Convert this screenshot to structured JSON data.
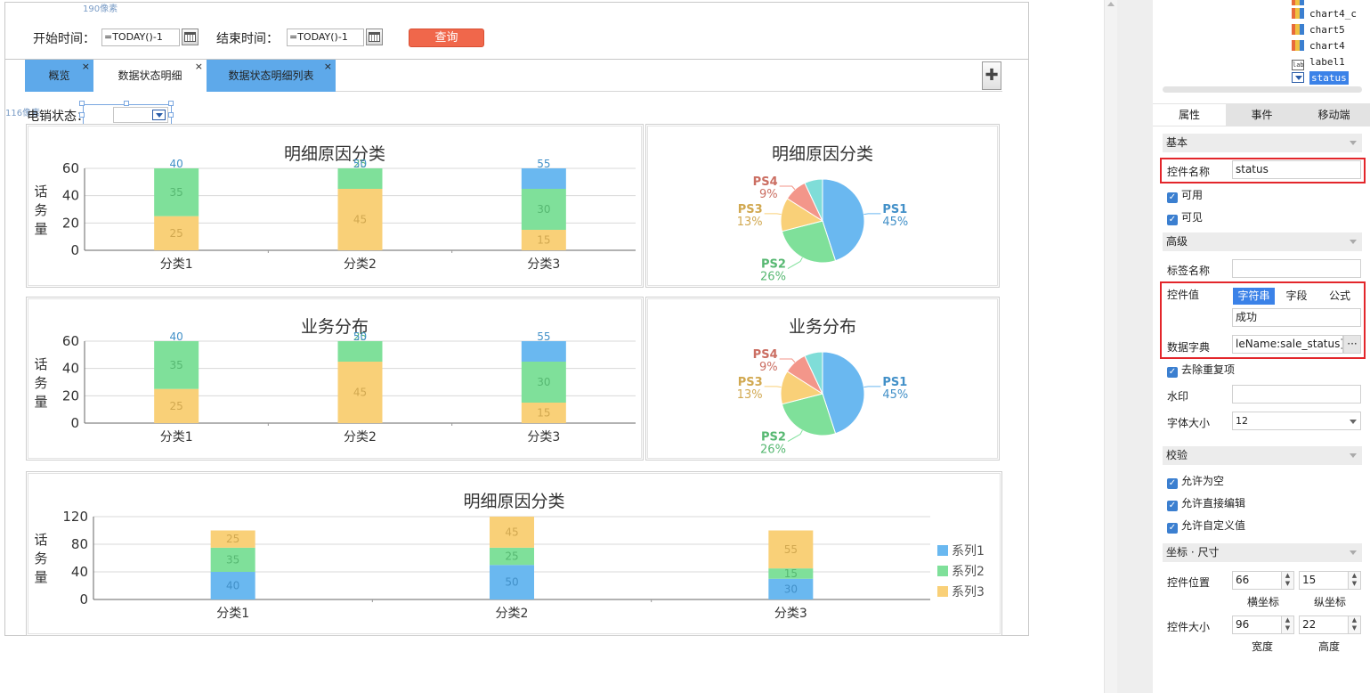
{
  "canvas": {
    "ruler_top": "190像素",
    "ruler_left": "116像素",
    "start_time_label": "开始时间：",
    "start_time_value": "=TODAY()-1",
    "end_time_label": "结束时间：",
    "end_time_value": "=TODAY()-1",
    "query_button": "查询",
    "tabs": [
      {
        "label": "概览",
        "close": "×",
        "active": false
      },
      {
        "label": "数据状态明细",
        "close": "×",
        "active": true
      },
      {
        "label": "数据状态明细列表",
        "close": "×",
        "active": false
      }
    ],
    "add_tab": "✚",
    "status_filter_label": "电销状态："
  },
  "charts": {
    "bar1_title": "明细原因分类",
    "pie1_title": "明细原因分类",
    "bar2_title": "业务分布",
    "pie2_title": "业务分布",
    "bar3_title": "明细原因分类"
  },
  "chart_data": [
    {
      "type": "bar",
      "title": "明细原因分类",
      "ylabel": "话务量",
      "categories": [
        "分类1",
        "分类2",
        "分类3"
      ],
      "ylim": [
        0,
        60
      ],
      "yticks": [
        0,
        20,
        40,
        60
      ],
      "series": [
        {
          "values": [
            25,
            45,
            15
          ],
          "color": "#f9d078"
        },
        {
          "values": [
            35,
            25,
            30
          ],
          "color": "#7fe09a"
        },
        {
          "values": [
            40,
            50,
            55
          ],
          "color": "#6ab8f0"
        }
      ],
      "stacked": true,
      "grid": true
    },
    {
      "type": "pie",
      "title": "明细原因分类",
      "slices": [
        {
          "label": "PS1",
          "value": 45,
          "pct": "45%",
          "color": "#6ab8f0"
        },
        {
          "label": "PS2",
          "value": 26,
          "pct": "26%",
          "color": "#7fe09a"
        },
        {
          "label": "PS3",
          "value": 13,
          "pct": "13%",
          "color": "#f9d078"
        },
        {
          "label": "PS4",
          "value": 9,
          "pct": "9%",
          "color": "#f3968a"
        },
        {
          "label": "",
          "value": 7,
          "pct": "",
          "color": "#7fddd8"
        }
      ]
    },
    {
      "type": "bar",
      "title": "业务分布",
      "ylabel": "话务量",
      "categories": [
        "分类1",
        "分类2",
        "分类3"
      ],
      "ylim": [
        0,
        60
      ],
      "yticks": [
        0,
        20,
        40,
        60
      ],
      "series": [
        {
          "values": [
            25,
            45,
            15
          ],
          "color": "#f9d078"
        },
        {
          "values": [
            35,
            25,
            30
          ],
          "color": "#7fe09a"
        },
        {
          "values": [
            40,
            50,
            55
          ],
          "color": "#6ab8f0"
        }
      ],
      "stacked": true,
      "grid": true
    },
    {
      "type": "pie",
      "title": "业务分布",
      "slices": [
        {
          "label": "PS1",
          "value": 45,
          "pct": "45%",
          "color": "#6ab8f0"
        },
        {
          "label": "PS2",
          "value": 26,
          "pct": "26%",
          "color": "#7fe09a"
        },
        {
          "label": "PS3",
          "value": 13,
          "pct": "13%",
          "color": "#f9d078"
        },
        {
          "label": "PS4",
          "value": 9,
          "pct": "9%",
          "color": "#f3968a"
        },
        {
          "label": "",
          "value": 7,
          "pct": "",
          "color": "#7fddd8"
        }
      ]
    },
    {
      "type": "bar",
      "title": "明细原因分类",
      "ylabel": "话务量",
      "categories": [
        "分类1",
        "分类2",
        "分类3"
      ],
      "ylim": [
        0,
        120
      ],
      "yticks": [
        0,
        40,
        80,
        120
      ],
      "series": [
        {
          "name": "系列1",
          "values": [
            40,
            50,
            30
          ],
          "color": "#6ab8f0"
        },
        {
          "name": "系列2",
          "values": [
            35,
            25,
            15
          ],
          "color": "#7fe09a"
        },
        {
          "name": "系列3",
          "values": [
            25,
            45,
            55
          ],
          "color": "#f9d078"
        }
      ],
      "stacked": true,
      "grid": true,
      "legend": "right"
    }
  ],
  "tree": {
    "items": [
      {
        "label": "chart4_c",
        "icon": "chart-icon"
      },
      {
        "label": "chart5",
        "icon": "chart-icon"
      },
      {
        "label": "chart4",
        "icon": "chart-icon"
      },
      {
        "label": "label1",
        "icon": "label-icon"
      },
      {
        "label": "status",
        "icon": "combo-icon",
        "selected": true
      }
    ]
  },
  "props": {
    "tabs": [
      "属性",
      "事件",
      "移动端"
    ],
    "basic_header": "基本",
    "widget_name_label": "控件名称",
    "widget_name_value": "status",
    "enabled_label": "可用",
    "visible_label": "可见",
    "advanced_header": "高级",
    "tag_name_label": "标签名称",
    "tag_name_value": "",
    "widget_value_label": "控件值",
    "value_types": [
      "字符串",
      "字段",
      "公式"
    ],
    "widget_value": "成功",
    "dict_label": "数据字典",
    "dict_value": "leName:sale_status]",
    "dict_more": "···",
    "dedupe_label": "去除重复项",
    "watermark_label": "水印",
    "watermark_value": "",
    "font_size_label": "字体大小",
    "font_size_value": "12",
    "validate_header": "校验",
    "allow_empty_label": "允许为空",
    "allow_edit_label": "允许直接编辑",
    "allow_custom_label": "允许自定义值",
    "coords_header": "坐标 · 尺寸",
    "position_label": "控件位置",
    "pos_x": "66",
    "pos_y": "15",
    "x_label": "横坐标",
    "y_label": "纵坐标",
    "size_label": "控件大小",
    "width": "96",
    "height": "22",
    "width_label": "宽度",
    "height_label": "高度"
  }
}
